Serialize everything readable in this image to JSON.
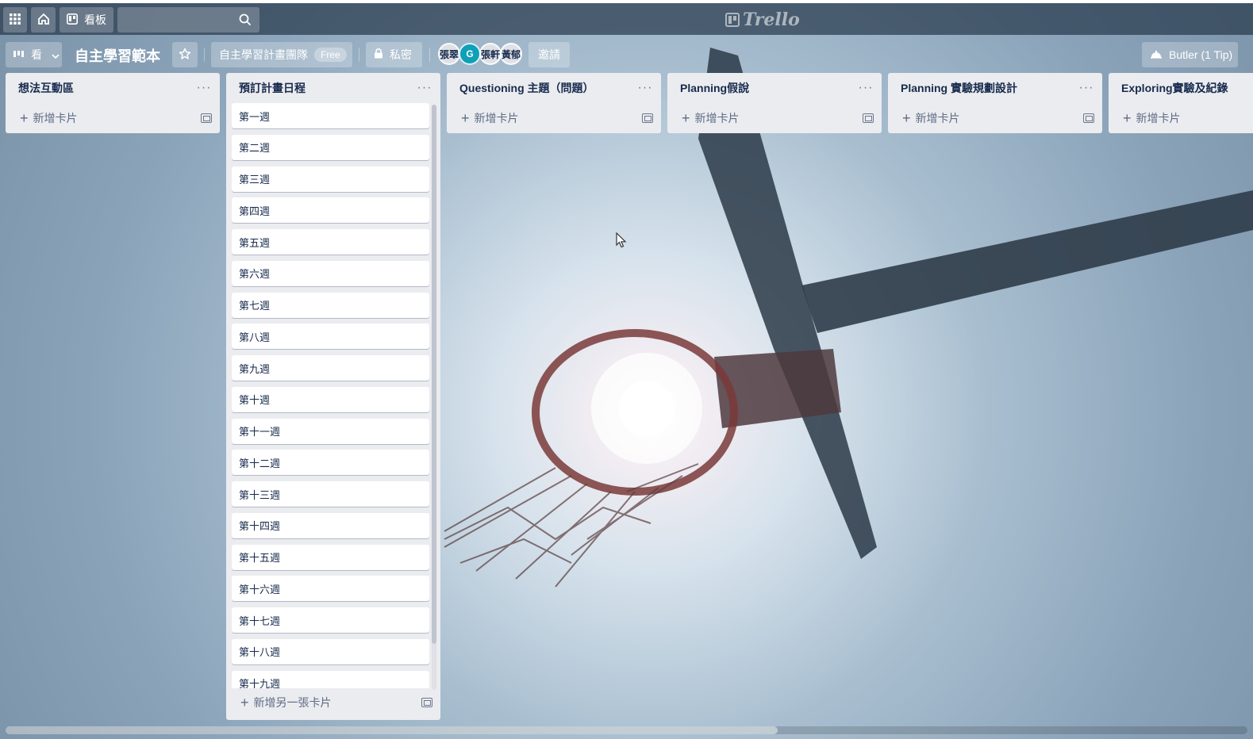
{
  "header": {
    "apps_icon": "grid-icon",
    "home_icon": "home-icon",
    "boards_label": "看板",
    "search_placeholder": "",
    "logo_text": "Trello"
  },
  "board": {
    "view_label": "看",
    "title": "自主學習範本",
    "team_label": "自主學習計畫團隊",
    "free_badge": "Free",
    "visibility_label": "私密",
    "members": [
      "張翠",
      "G",
      "張軒",
      "黃郁"
    ],
    "invite_label": "邀請",
    "butler_label": "Butler (1 Tip)"
  },
  "lists": [
    {
      "title": "想法互動區",
      "add_label": "新增卡片",
      "cards": []
    },
    {
      "title": "預訂計畫日程",
      "add_label": "新增另一張卡片",
      "cards": [
        "第一週",
        "第二週",
        "第三週",
        "第四週",
        "第五週",
        "第六週",
        "第七週",
        "第八週",
        "第九週",
        "第十週",
        "第十一週",
        "第十二週",
        "第十三週",
        "第十四週",
        "第十五週",
        "第十六週",
        "第十七週",
        "第十八週",
        "第十九週"
      ]
    },
    {
      "title": "Questioning 主題（問題）",
      "add_label": "新增卡片",
      "cards": []
    },
    {
      "title": "Planning假說",
      "add_label": "新增卡片",
      "cards": []
    },
    {
      "title": "Planning 實驗規劃設計",
      "add_label": "新增卡片",
      "cards": []
    },
    {
      "title": "Exploring實驗及紀錄",
      "add_label": "新增卡片",
      "cards": []
    }
  ],
  "list_menu_glyph": "···",
  "colors": {
    "list_bg": "#ebecf0",
    "header_bg": "#283a4e",
    "card_bg": "#ffffff"
  }
}
